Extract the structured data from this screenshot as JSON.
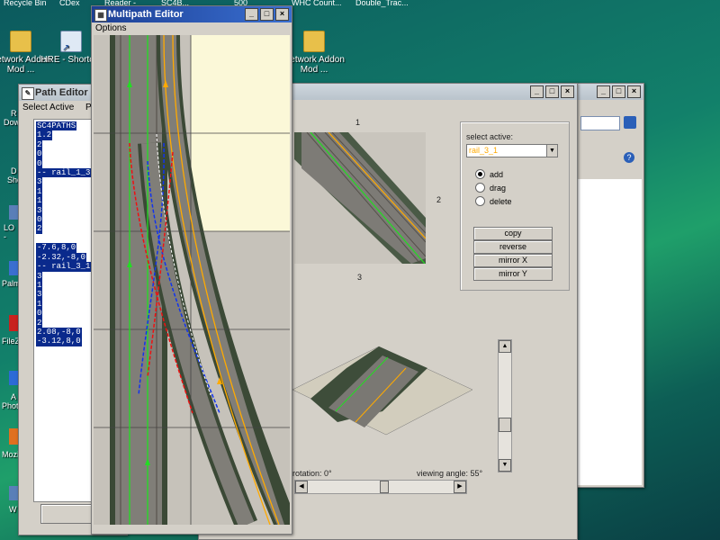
{
  "desktop": {
    "top_labels": [
      "Recycle Bin",
      "CDex",
      "Reader -",
      "_SC4B...",
      "500",
      "WHC Count...",
      "Double_Trac..."
    ],
    "icons": [
      {
        "label": "Network Addon Mod ...",
        "type": "folder"
      },
      {
        "label": "HRE - Shortcut",
        "type": "shortcut"
      },
      {
        "label": "Network Addon Mod ...",
        "type": "folder"
      }
    ],
    "left_labels": [
      "R",
      "Dow",
      "D",
      "Sho",
      "LO -",
      "Palm",
      "FileZ",
      "A",
      "Photo",
      "Mozil",
      "W"
    ]
  },
  "path_editor": {
    "title": "Path Editor (X-...",
    "menu": [
      "Select Active",
      "Path C"
    ],
    "text_lines": [
      "SC4PATHS",
      "1.2",
      "2",
      "0",
      "0",
      "-- rail_1_3",
      "3",
      "1",
      "1",
      "3",
      "0",
      "2",
      "-7.6,8,0",
      "-2.32,-8,0",
      "-- rail_3_1",
      "3",
      "1",
      "3",
      "1",
      "0",
      "2",
      "2.08,-8,0",
      "-3.12,8,0"
    ]
  },
  "multipath_editor": {
    "title": "Multipath Editor",
    "menu": [
      "Options"
    ]
  },
  "main_window": {
    "view_labels": {
      "top": "1",
      "right": "2",
      "bottom": "3"
    },
    "select_active_label": "select active:",
    "select_active_value": "rail_3_1",
    "modes": [
      {
        "label": "add",
        "selected": true
      },
      {
        "label": "drag",
        "selected": false
      },
      {
        "label": "delete",
        "selected": false
      }
    ],
    "buttons": [
      "copy",
      "reverse",
      "mirror X",
      "mirror Y"
    ],
    "rotation_label": "rotation: 0°",
    "viewing_angle_label": "viewing angle: 55°"
  },
  "colors": {
    "title_active": "#1c3f94",
    "path_green": "#22dd22",
    "path_orange": "#ffaa00",
    "path_red": "#ee1111",
    "path_blue": "#1133ee",
    "path_white": "#ffffff",
    "selection_blue": "#0a2a8c"
  }
}
